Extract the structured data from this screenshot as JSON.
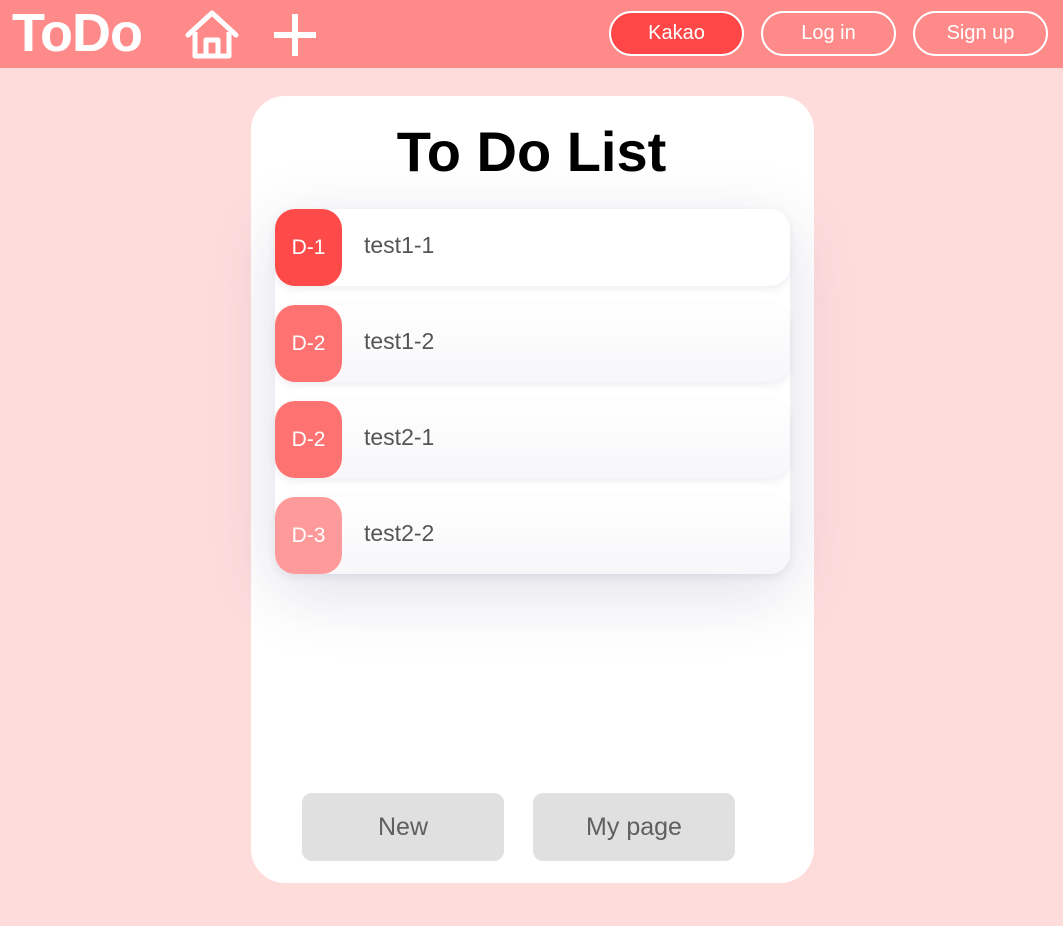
{
  "header": {
    "logo": "ToDo",
    "icons": {
      "home": "home-icon",
      "add": "plus-icon"
    },
    "kakao_label": "Kakao",
    "login_label": "Log in",
    "signup_label": "Sign up"
  },
  "main": {
    "title": "To Do List",
    "items": [
      {
        "dday": "D-1",
        "text": "test1-1",
        "color": "#ff4a4a"
      },
      {
        "dday": "D-2",
        "text": "test1-2",
        "color": "#ff7272"
      },
      {
        "dday": "D-2",
        "text": "test2-1",
        "color": "#ff7272"
      },
      {
        "dday": "D-3",
        "text": "test2-2",
        "color": "#ff9a9a"
      }
    ],
    "new_label": "New",
    "mypage_label": "My page"
  },
  "colors": {
    "background": "#ffdcdc",
    "topbar": "#ff8a8a",
    "accent": "#ff4747",
    "button_gray": "#e0e0e0"
  }
}
